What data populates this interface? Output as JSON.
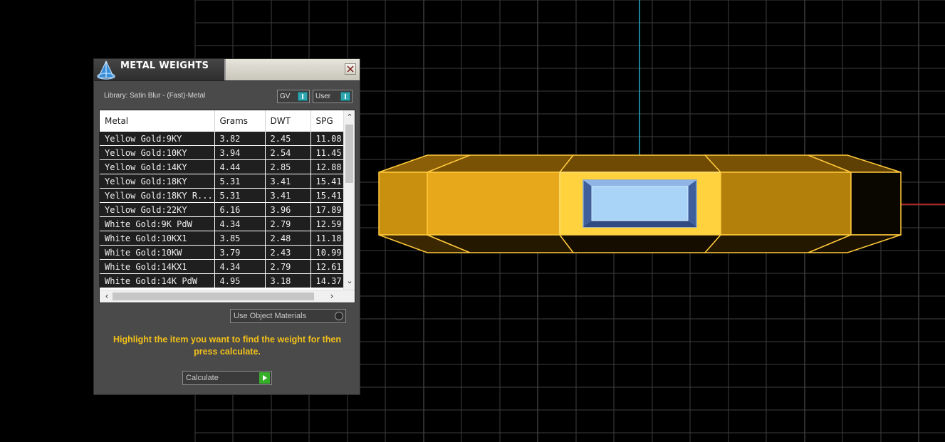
{
  "panel": {
    "title": "METAL WEIGHTS",
    "library_label": "Library: Satin Blur - (Fast)-Metal",
    "toggles": {
      "gv": "GV",
      "user": "User"
    },
    "table": {
      "columns": [
        "Metal",
        "Grams",
        "DWT",
        "SPG"
      ],
      "rows": [
        [
          "Yellow Gold:9KY",
          "3.82",
          "2.45",
          "11.08"
        ],
        [
          "Yellow Gold:10KY",
          "3.94",
          "2.54",
          "11.45"
        ],
        [
          "Yellow Gold:14KY",
          "4.44",
          "2.85",
          "12.88"
        ],
        [
          "Yellow Gold:18KY",
          "5.31",
          "3.41",
          "15.41"
        ],
        [
          "Yellow Gold:18KY R...",
          "5.31",
          "3.41",
          "15.41"
        ],
        [
          "Yellow Gold:22KY",
          "6.16",
          "3.96",
          "17.89"
        ],
        [
          "White Gold:9K PdW",
          "4.34",
          "2.79",
          "12.59"
        ],
        [
          "White Gold:10KX1",
          "3.85",
          "2.48",
          "11.18"
        ],
        [
          "White Gold:10KW",
          "3.79",
          "2.43",
          "10.99"
        ],
        [
          "White Gold:14KX1",
          "4.34",
          "2.79",
          "12.61"
        ],
        [
          "White Gold:14K PdW",
          "4.95",
          "3.18",
          "14.37"
        ]
      ]
    },
    "use_object_materials": "Use Object Materials",
    "instructions": "Highlight the item you want to find the weight for then press calculate.",
    "calculate_label": "Calculate"
  },
  "colors": {
    "accent_teal": "#2fa6b0",
    "instruction_yellow": "#f2c01a",
    "go_green": "#36b02b",
    "gold": "#e8a81c",
    "gem_blue": "#a9d4f7"
  },
  "icons": {
    "app_logo": "app-logo-icon",
    "close": "close-icon",
    "go": "play-arrow-icon"
  }
}
